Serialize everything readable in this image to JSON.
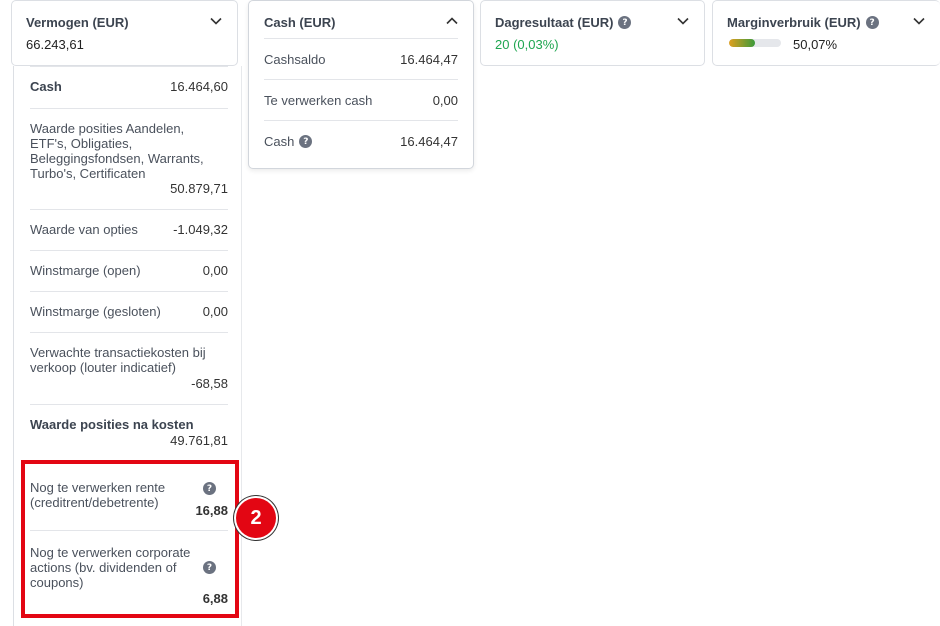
{
  "cards": {
    "vermogen": {
      "title": "Vermogen (EUR)",
      "value": "66.243,61"
    },
    "cash": {
      "title": "Cash (EUR)"
    },
    "dagresultaat": {
      "title": "Dagresultaat (EUR)",
      "value": "20 (0,03%)"
    },
    "margin": {
      "title": "Marginverbruik (EUR)",
      "value": "50,07%",
      "fill_fraction": 0.5007
    }
  },
  "cash_panel": {
    "rows": [
      {
        "label": "Cashsaldo",
        "value": "16.464,47"
      },
      {
        "label": "Te verwerken cash",
        "value": "0,00"
      },
      {
        "label": "Cash",
        "value": "16.464,47"
      }
    ]
  },
  "vermogen_panel": {
    "rows": [
      {
        "label": "Cash",
        "value": "16.464,60"
      },
      {
        "label": "Waarde posities Aandelen, ETF's, Obligaties, Beleggingsfondsen, Warrants, Turbo's, Certificaten",
        "value": "50.879,71"
      },
      {
        "label": "Waarde van opties",
        "value": "-1.049,32"
      },
      {
        "label": "Winstmarge (open)",
        "value": "0,00"
      },
      {
        "label": "Winstmarge (gesloten)",
        "value": "0,00"
      },
      {
        "label": "Verwachte transactiekosten bij verkoop (louter indicatief)",
        "value": "-68,58"
      },
      {
        "label": "Waarde posities na kosten",
        "value": "49.761,81"
      },
      {
        "label": "Nog te verwerken rente (creditrent/debetrente)",
        "value": "16,88"
      },
      {
        "label": "Nog te verwerken corporate actions (bv. dividenden of coupons)",
        "value": "6,88"
      }
    ]
  },
  "annotation": {
    "marker": "2"
  },
  "colors": {
    "highlight": "#e30613",
    "positive": "#1fa650",
    "link_value": "#1f5fbf"
  }
}
